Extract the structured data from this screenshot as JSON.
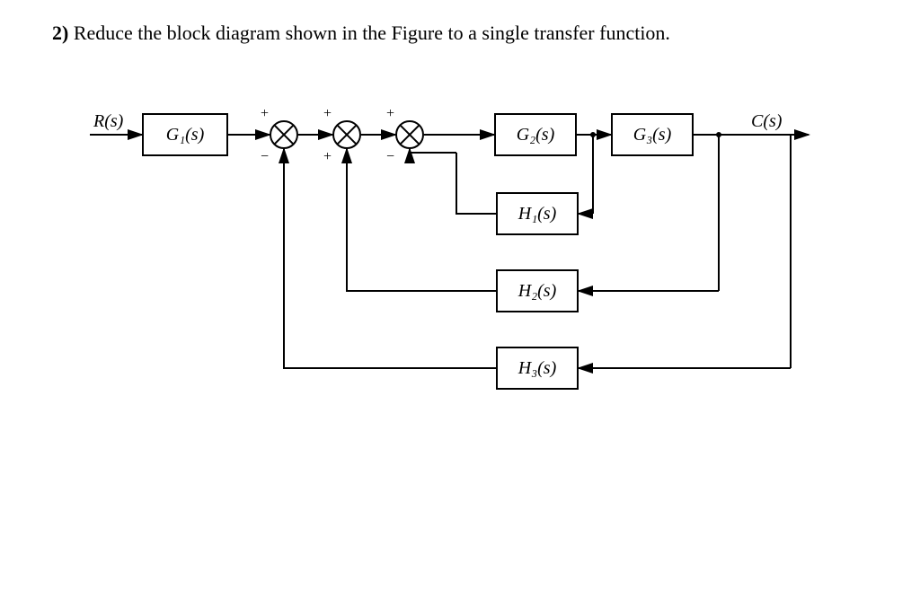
{
  "question": {
    "number": "2)",
    "text": "Reduce the block diagram shown in the Figure to a single transfer function."
  },
  "labels": {
    "input": "R(s)",
    "output": "C(s)"
  },
  "blocks": {
    "G1": "G₁(s)",
    "G2": "G₂(s)",
    "G3": "G₃(s)",
    "H1": "H₁(s)",
    "H2": "H₂(s)",
    "H3": "H₃(s)"
  },
  "summers": {
    "S1": {
      "top": "+",
      "bottom": "−"
    },
    "S2": {
      "top": "+",
      "bottom": "+"
    },
    "S3": {
      "top": "+",
      "bottom": "−"
    }
  },
  "diagram": {
    "forward_path": [
      "G1",
      "S1",
      "S2",
      "S3",
      "G2",
      "G3"
    ],
    "feedbacks": [
      {
        "block": "H1",
        "from_after": "G2",
        "to_summer": "S3",
        "sign": "−"
      },
      {
        "block": "H2",
        "from_after": "G3",
        "to_summer": "S2",
        "sign": "+"
      },
      {
        "block": "H3",
        "from_after": "G3",
        "to_summer": "S1",
        "sign": "−"
      }
    ]
  },
  "chart_data": {
    "type": "block-diagram",
    "input": "R(s)",
    "output": "C(s)",
    "forward_blocks": [
      "G1(s)",
      "G2(s)",
      "G3(s)"
    ],
    "summing_junctions": [
      {
        "id": "S1",
        "inputs": [
          {
            "src": "G1",
            "sign": "+"
          },
          {
            "src": "H3",
            "sign": "-"
          }
        ]
      },
      {
        "id": "S2",
        "inputs": [
          {
            "src": "S1",
            "sign": "+"
          },
          {
            "src": "H2",
            "sign": "+"
          }
        ]
      },
      {
        "id": "S3",
        "inputs": [
          {
            "src": "S2",
            "sign": "+"
          },
          {
            "src": "H1",
            "sign": "-"
          }
        ]
      }
    ],
    "feedback_blocks": [
      {
        "name": "H1(s)",
        "tap_after": "G2(s)",
        "feeds": "S3",
        "sign": "-"
      },
      {
        "name": "H2(s)",
        "tap_after": "G3(s)",
        "feeds": "S2",
        "sign": "+"
      },
      {
        "name": "H3(s)",
        "tap_after": "G3(s)",
        "feeds": "S1",
        "sign": "-"
      }
    ]
  }
}
